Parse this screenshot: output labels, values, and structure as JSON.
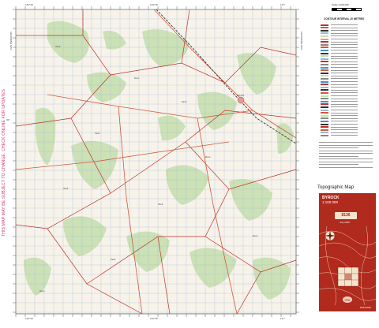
{
  "map_data": {
    "type": "topographic",
    "note_left": "THIS MAP MAY BE SUBJECT TO CHANGE. CHECK ONLINE FOR UPDATES",
    "coordinate_labels": {
      "top": [
        "146°30'",
        "146°45'",
        "147°"
      ],
      "left": [
        "32°"
      ],
      "bottom": [
        "146°30'",
        "146°45'",
        "147°"
      ]
    },
    "side_labels": {
      "left": "ADJOINING MAP",
      "right": "ADJOINING MAP"
    },
    "legend": {
      "scale_text": "Scale 1:100,000",
      "contour_header": "CONTOUR INTERVAL 20 METRES",
      "title": "Topographic Map"
    },
    "cover": {
      "map_name": "BYROCK",
      "scale": "1:100 000",
      "sheet_number": "8136",
      "date": "July 2025",
      "code": "60AS1020",
      "crest": "NSW"
    },
    "colors": {
      "map_background": "#f7f3ea",
      "vegetation": "#c8e0b0",
      "grid": "#9ab8d6",
      "boundary": "#c0302a",
      "road": "#d05a3a",
      "railway": "#333333",
      "cover_red": "#b02a1e",
      "cover_cream": "#f5e4cc",
      "note_pink": "#d6336c"
    }
  }
}
